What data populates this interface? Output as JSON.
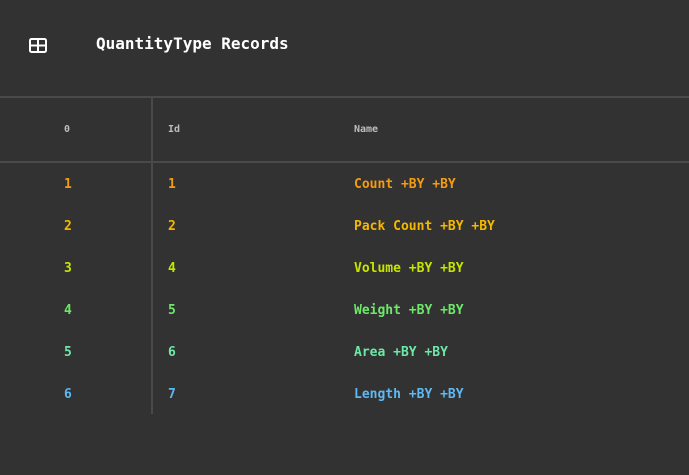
{
  "header": {
    "title": "QuantityType Records",
    "icon": "table-icon"
  },
  "table": {
    "columns": [
      "0",
      "Id",
      "Name"
    ],
    "rows": [
      {
        "index": "1",
        "id": "1",
        "name": "Count +BY +BY",
        "color": "#f39c12"
      },
      {
        "index": "2",
        "id": "2",
        "name": "Pack Count +BY +BY",
        "color": "#f5b800"
      },
      {
        "index": "3",
        "id": "4",
        "name": "Volume +BY +BY",
        "color": "#c6e500"
      },
      {
        "index": "4",
        "id": "5",
        "name": "Weight +BY +BY",
        "color": "#6ee86a"
      },
      {
        "index": "5",
        "id": "6",
        "name": "Area +BY +BY",
        "color": "#6de8a6"
      },
      {
        "index": "6",
        "id": "7",
        "name": "Length +BY +BY",
        "color": "#5fb8f0"
      }
    ]
  }
}
